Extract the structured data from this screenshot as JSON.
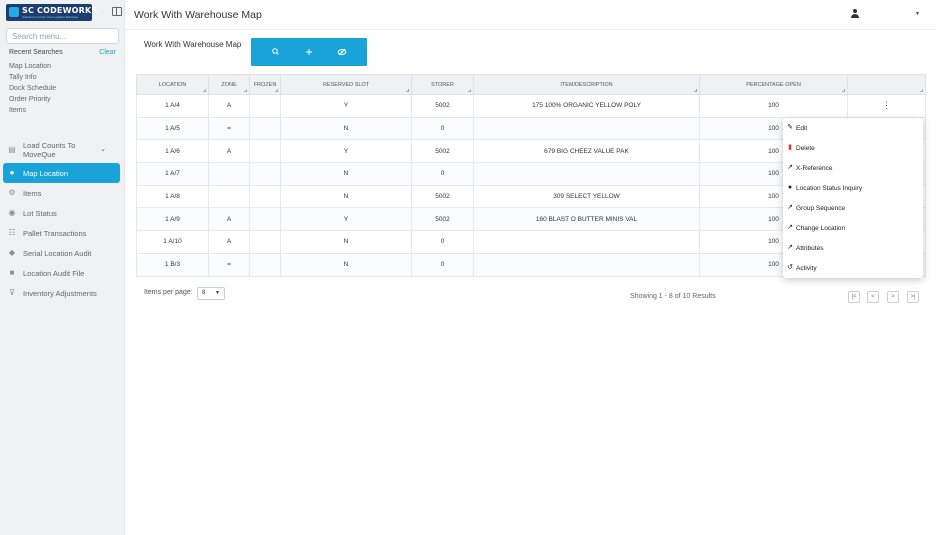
{
  "logo": {
    "text": "SC CODEWORKS",
    "tagline": "Solutions to Grow Your Logistics Business"
  },
  "sidebar": {
    "search_placeholder": "Search menu...",
    "recent_title": "Recent Searches",
    "clear_label": "Clear",
    "recent": [
      "Map Location",
      "Tally Info",
      "Dock Schedule",
      "Order Priority",
      "Items"
    ],
    "nav": [
      {
        "label": "Load Counts To MoveQue",
        "icon": "list-icon",
        "expandable": true
      },
      {
        "label": "Map Location",
        "icon": "location-pin-icon",
        "active": true
      },
      {
        "label": "Items",
        "icon": "gear-icon"
      },
      {
        "label": "Lot Status",
        "icon": "lot-icon"
      },
      {
        "label": "Pallet Transactions",
        "icon": "pallet-icon"
      },
      {
        "label": "Serial Location Audit",
        "icon": "shield-icon"
      },
      {
        "label": "Location Audit File",
        "icon": "file-icon"
      },
      {
        "label": "Inventory Adjustments",
        "icon": "adjust-icon"
      }
    ]
  },
  "header": {
    "title": "Work With Warehouse Map"
  },
  "main": {
    "section_title": "Work With Warehouse Map",
    "toolbar": [
      "search-icon",
      "plus-icon",
      "hide-icon"
    ]
  },
  "table": {
    "columns": [
      "LOCATION",
      "ZONE",
      "FROZEN",
      "RESERVED SLOT",
      "STORER",
      "ITEM/DESCRIPTION",
      "PERCENTAGE OPEN",
      ""
    ],
    "rows": [
      [
        "1 A/4",
        "A",
        "",
        "Y",
        "5002",
        "175 100% ORGANIC YELLOW POLY",
        "100"
      ],
      [
        "1 A/5",
        "=",
        "",
        "N",
        "0",
        "",
        "100"
      ],
      [
        "1 A/6",
        "A",
        "",
        "Y",
        "5002",
        "679 BIG CHEEZ VALUE PAK",
        "100"
      ],
      [
        "1 A/7",
        "",
        "",
        "N",
        "0",
        "",
        "100"
      ],
      [
        "1 A/8",
        "",
        "",
        "N",
        "5002",
        "309 SELECT YELLOW",
        "100"
      ],
      [
        "1 A/9",
        "A",
        "",
        "Y",
        "5002",
        "160 BLAST O BUTTER MINIS VAL",
        "100"
      ],
      [
        "1 A/10",
        "A",
        "",
        "N",
        "0",
        "",
        "100"
      ],
      [
        "1 B/3",
        "=",
        "",
        "N",
        "0",
        "",
        "100"
      ]
    ]
  },
  "pager": {
    "label": "Items per page:",
    "size": "8",
    "info": "Showing 1 - 8 of 10 Results"
  },
  "context_menu": [
    {
      "label": "Edit",
      "icon": "pencil-icon"
    },
    {
      "label": "Delete",
      "icon": "trash-icon"
    },
    {
      "label": "X-Reference",
      "icon": "arrow-icon"
    },
    {
      "label": "Location Status Inquiry",
      "icon": "location-pin-icon"
    },
    {
      "label": "Group Sequence",
      "icon": "arrow-icon"
    },
    {
      "label": "Change Location",
      "icon": "arrow-icon"
    },
    {
      "label": "Attributes",
      "icon": "arrow-icon"
    },
    {
      "label": "Activity",
      "icon": "history-icon"
    }
  ],
  "colors": {
    "accent": "#1aa3d9",
    "brand_navy": "#1c3d6e",
    "delete": "#e53935"
  }
}
